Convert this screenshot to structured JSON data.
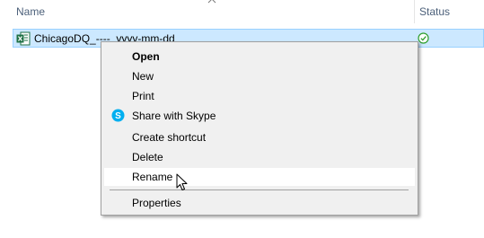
{
  "columns": {
    "name": "Name",
    "status": "Status"
  },
  "file": {
    "name": "ChicagoDQ_----  yyyy-mm-dd",
    "icon": "excel-file-icon",
    "status_icon": "synced-check-icon"
  },
  "context_menu": {
    "items": [
      {
        "label": "Open",
        "bold": true
      },
      {
        "label": "New"
      },
      {
        "label": "Print"
      },
      {
        "label": "Share with Skype",
        "icon": "skype-icon"
      },
      {
        "label": "Create shortcut"
      },
      {
        "label": "Delete"
      },
      {
        "label": "Rename",
        "hovered": true
      },
      {
        "label": "Properties"
      }
    ]
  },
  "colors": {
    "selection_bg": "#cce8ff",
    "selection_border": "#99d1ff",
    "menu_bg": "#f0f0f0",
    "excel_green": "#1d7044",
    "skype_blue": "#00aff0",
    "sync_green": "#2e9e2e"
  }
}
